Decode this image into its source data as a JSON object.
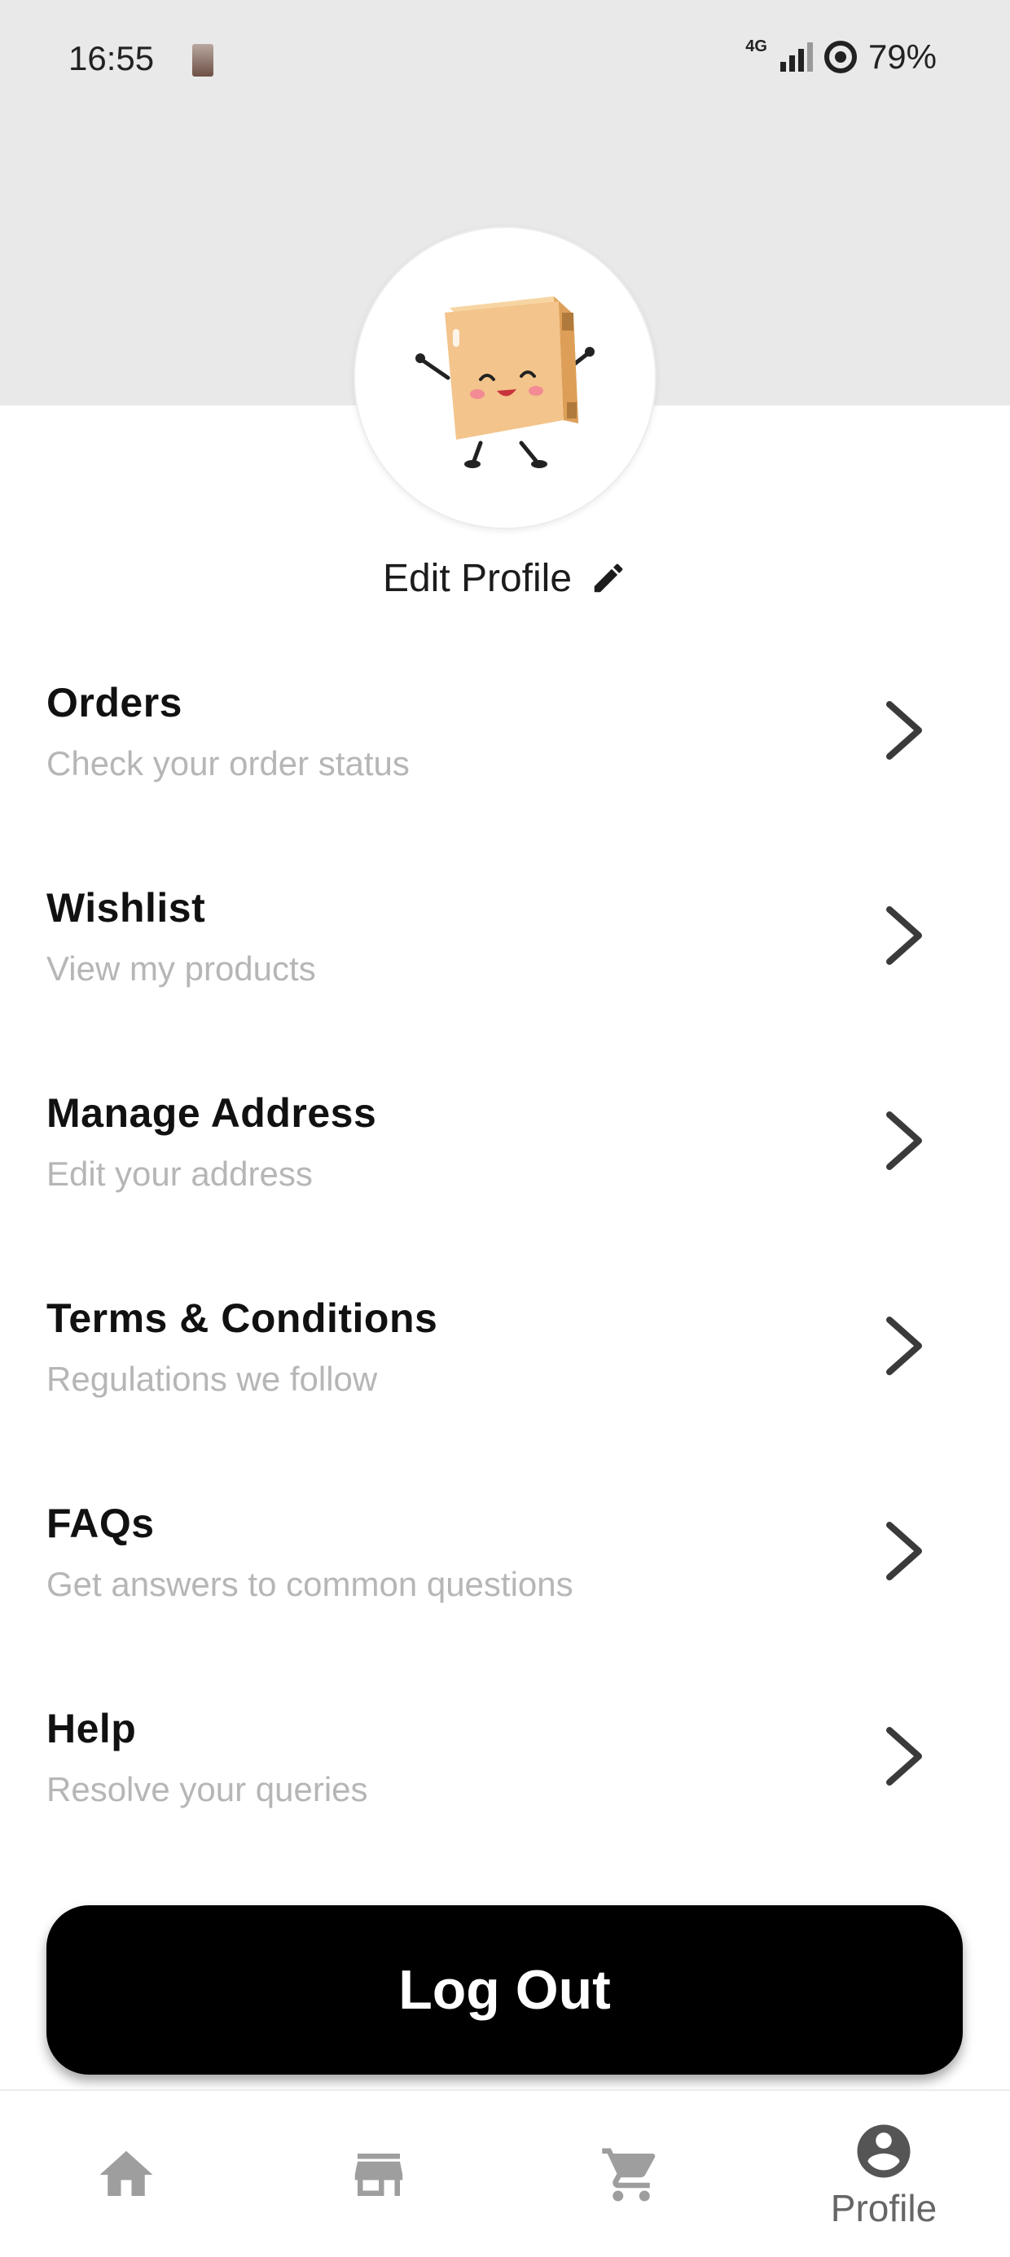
{
  "status_bar": {
    "time": "16:55",
    "network": "4G",
    "battery": "79%"
  },
  "profile": {
    "edit_label": "Edit Profile"
  },
  "menu": [
    {
      "title": "Orders",
      "subtitle": "Check your order status"
    },
    {
      "title": "Wishlist",
      "subtitle": "View my products"
    },
    {
      "title": "Manage Address",
      "subtitle": "Edit your address"
    },
    {
      "title": "Terms & Conditions",
      "subtitle": "Regulations we follow"
    },
    {
      "title": "FAQs",
      "subtitle": "Get answers to common questions"
    },
    {
      "title": "Help",
      "subtitle": "Resolve your queries"
    }
  ],
  "logout_label": "Log Out",
  "bottom_nav": {
    "items": [
      {
        "icon": "home-icon"
      },
      {
        "icon": "store-icon"
      },
      {
        "icon": "cart-icon"
      },
      {
        "icon": "account-icon",
        "label": "Profile",
        "active": true
      }
    ]
  },
  "colors": {
    "header_bg": "#e9e9e9",
    "subtitle": "#b6b6b6",
    "button_bg": "#000000",
    "nav_icon": "#9e9e9e",
    "nav_active": "#555555"
  }
}
